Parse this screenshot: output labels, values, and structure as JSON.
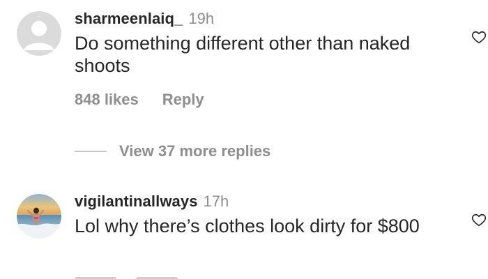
{
  "comments": [
    {
      "username": "sharmeenlaiq_",
      "time": "19h",
      "text": "Do something different other than naked shoots",
      "likes": "848 likes",
      "reply": "Reply",
      "avatar_icon": "default-avatar-icon",
      "liked": false
    },
    {
      "username": "vigilantinallways",
      "time": "17h",
      "text": "Lol why there’s clothes look dirty for $800",
      "avatar_icon": "beach-photo-avatar",
      "liked": false
    }
  ],
  "view_more": "View 37 more replies",
  "icons": {
    "like": "heart-outline-icon"
  },
  "colors": {
    "text": "#262626",
    "muted": "#8e8e8e",
    "avatar_bg": "#dbdbdb"
  }
}
